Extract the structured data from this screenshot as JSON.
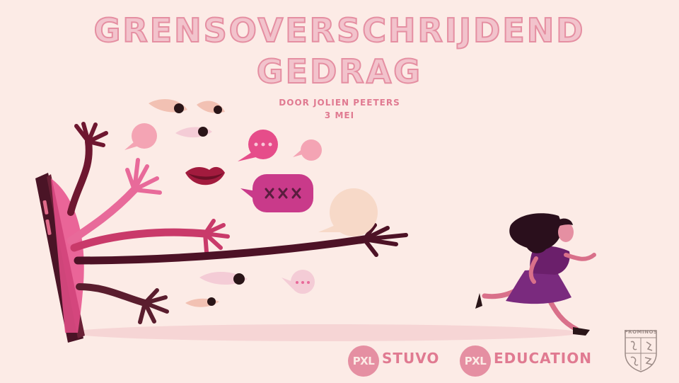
{
  "title": {
    "line1": "GRENSOVERSCHRIJDEND",
    "line2": "GEDRAG"
  },
  "subtitle": {
    "author": "DOOR JOLIEN PEETERS",
    "date": "3 MEI"
  },
  "logos": {
    "stuvo_badge": "PXL",
    "stuvo_text": "STUVO",
    "education_badge": "PXL",
    "education_text": "EDUCATION",
    "prominos": "PROMINOS"
  },
  "colors": {
    "background": "#fcebe6",
    "title_fill": "#f2c3cc",
    "title_stroke": "#e58fa2",
    "accent": "#e07a91",
    "dark_arm": "#5a1d2e",
    "girl_dress": "#6b1f6b"
  }
}
